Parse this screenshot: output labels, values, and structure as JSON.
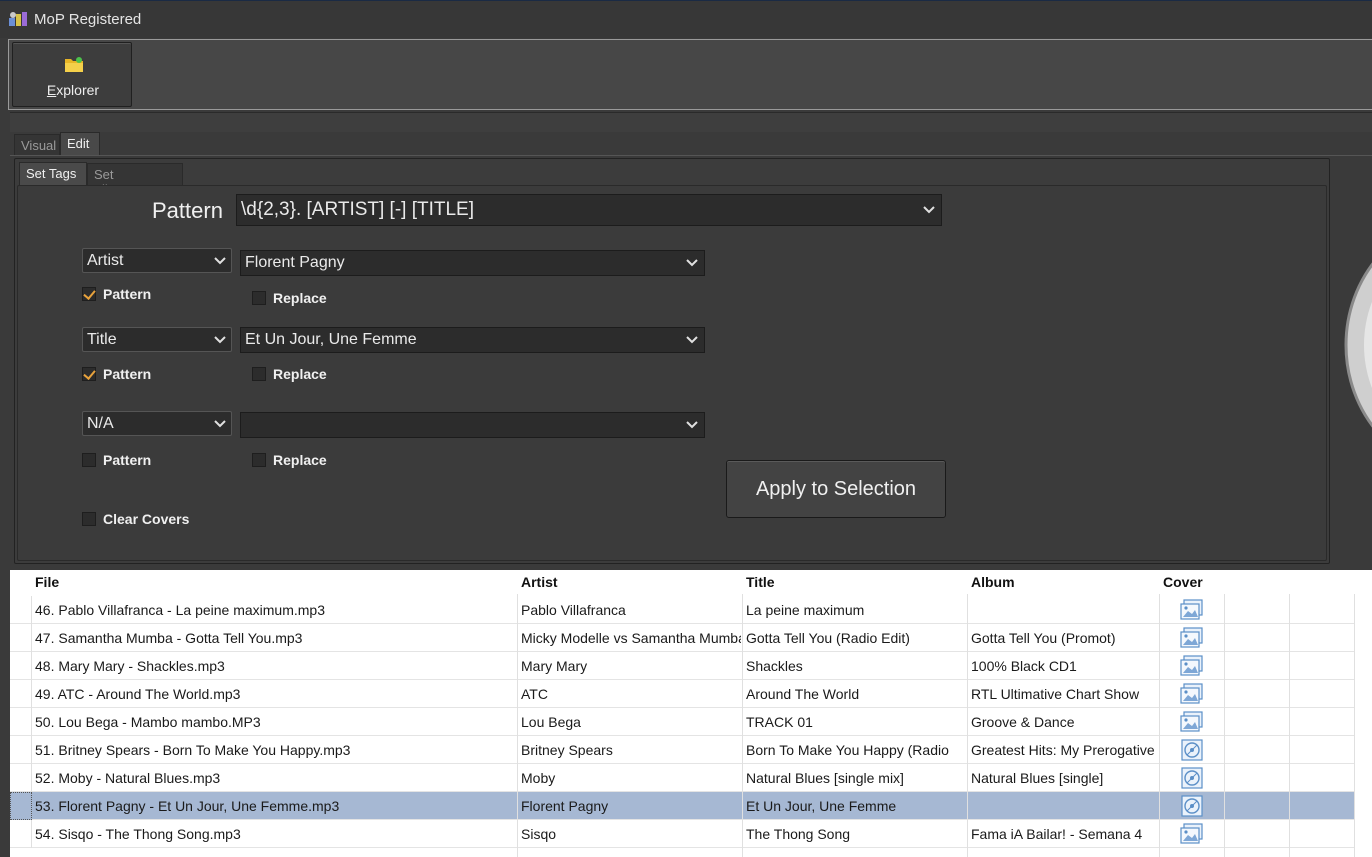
{
  "window": {
    "title": "MoP Registered",
    "icon": "app-logo-icon"
  },
  "toolbar": {
    "explorer_label_underlined": "E",
    "explorer_label_rest": "xplorer",
    "explorer_icon": "folder-icon"
  },
  "tabs": {
    "visual": "Visual",
    "edit": "Edit",
    "active": "Edit"
  },
  "subtabs": {
    "set_tags": "Set Tags",
    "set_filenames": "Set Filenames",
    "active": "Set Tags"
  },
  "form": {
    "pattern_label": "Pattern",
    "pattern_value": "\\d{2,3}. [ARTIST] [-] [TITLE]",
    "fields": [
      {
        "field": "Artist",
        "value": "Florent Pagny",
        "pattern_label": "Pattern",
        "pattern_checked": true,
        "replace_label": "Replace",
        "replace_checked": false
      },
      {
        "field": "Title",
        "value": "Et Un Jour, Une Femme",
        "pattern_label": "Pattern",
        "pattern_checked": true,
        "replace_label": "Replace",
        "replace_checked": false
      },
      {
        "field": "N/A",
        "value": "",
        "pattern_label": "Pattern",
        "pattern_checked": false,
        "replace_label": "Replace",
        "replace_checked": false
      }
    ],
    "clear_covers_label": "Clear Covers",
    "clear_covers_checked": false,
    "apply_label": "Apply to Selection"
  },
  "table": {
    "headers": {
      "file": "File",
      "artist": "Artist",
      "title": "Title",
      "album": "Album",
      "cover": "Cover"
    },
    "rows": [
      {
        "file": "46. Pablo Villafranca - La peine maximum.mp3",
        "artist": "Pablo Villafranca",
        "title": "La peine maximum",
        "album": "",
        "cover": "image-icon",
        "selected": false
      },
      {
        "file": "47. Samantha Mumba - Gotta Tell You.mp3",
        "artist": "Micky Modelle vs Samantha Mumba",
        "title": "Gotta Tell You (Radio Edit)",
        "album": "Gotta Tell You (Promot)",
        "cover": "image-icon",
        "selected": false
      },
      {
        "file": "48. Mary Mary - Shackles.mp3",
        "artist": "Mary Mary",
        "title": "Shackles",
        "album": "100% Black CD1",
        "cover": "image-icon",
        "selected": false
      },
      {
        "file": "49. ATC - Around The World.mp3",
        "artist": "ATC",
        "title": "Around The World",
        "album": "RTL Ultimative Chart Show",
        "cover": "image-icon",
        "selected": false
      },
      {
        "file": "50.  Lou Bega - Mambo mambo.MP3",
        "artist": "Lou Bega",
        "title": "TRACK 01",
        "album": "Groove & Dance",
        "cover": "image-icon",
        "selected": false
      },
      {
        "file": "51. Britney Spears - Born To Make You Happy.mp3",
        "artist": "Britney Spears",
        "title": "Born To Make You Happy (Radio",
        "album": "Greatest Hits: My Prerogative",
        "cover": "disc-icon",
        "selected": false
      },
      {
        "file": "52. Moby - Natural Blues.mp3",
        "artist": "Moby",
        "title": "Natural Blues [single mix]",
        "album": "Natural Blues [single]",
        "cover": "disc-icon",
        "selected": false
      },
      {
        "file": "53. Florent Pagny - Et Un Jour, Une Femme.mp3",
        "artist": "Florent Pagny",
        "title": "Et Un Jour, Une Femme",
        "album": "",
        "cover": "disc-icon",
        "selected": true
      },
      {
        "file": "54. Sisqo - The Thong Song.mp3",
        "artist": "Sisqo",
        "title": "The Thong Song",
        "album": "Fama iA Bailar! - Semana 4",
        "cover": "image-icon",
        "selected": false
      }
    ]
  },
  "colors": {
    "accent_check": "#e8a23c",
    "selection": "#a6b8d3",
    "dark_bg": "#3a3a3a"
  }
}
